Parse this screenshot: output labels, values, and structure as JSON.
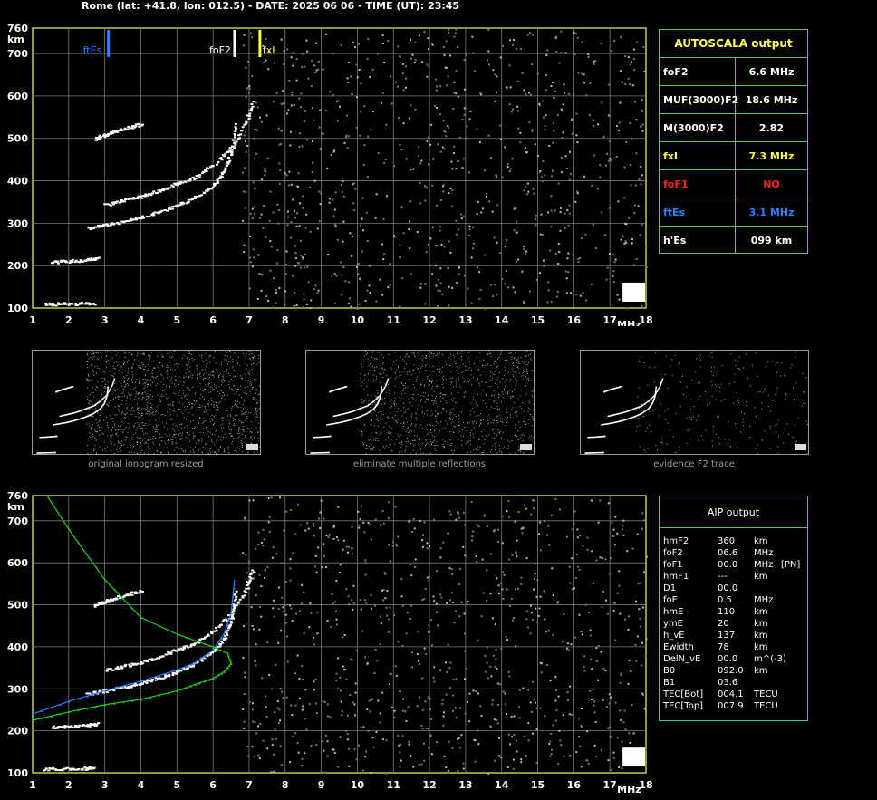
{
  "header": "Rome (lat: +41.8, lon: 012.5) - DATE: 2025 06 06 - TIME (UT): 23:45",
  "colors": {
    "grid": "#7a7a7a",
    "frame": "#c8c84a",
    "yellow": "#ffff33",
    "blue": "#2f7fff",
    "red": "#ff2020",
    "green": "#20d020",
    "trace": "#ffffff"
  },
  "axes": {
    "y_ticks": [
      "760",
      "700",
      "600",
      "500",
      "400",
      "300",
      "200",
      "100"
    ],
    "y_unit": "km",
    "x_ticks": [
      "1",
      "2",
      "3",
      "4",
      "5",
      "6",
      "7",
      "8",
      "9",
      "10",
      "11",
      "12",
      "13",
      "14",
      "15",
      "16",
      "17",
      "18"
    ],
    "x_unit": "MHz"
  },
  "markers": {
    "ftEs_label": "ftEs",
    "foF2_label": "foF2",
    "fxI_label": "fxI"
  },
  "autoscala": {
    "title": "AUTOSCALA output",
    "rows": [
      {
        "key": "foF2",
        "value": "6.6 MHz",
        "color": "#ffffff"
      },
      {
        "key": "MUF(3000)F2",
        "value": "18.6 MHz",
        "color": "#ffffff"
      },
      {
        "key": "M(3000)F2",
        "value": "2.82",
        "color": "#ffffff"
      },
      {
        "key": "fxI",
        "value": "7.3 MHz",
        "color": "#ffff33"
      },
      {
        "key": "foF1",
        "value": "NO",
        "color": "#ff2020"
      },
      {
        "key": "ftEs",
        "value": "3.1 MHz",
        "color": "#2f7fff"
      },
      {
        "key": "h'Es",
        "value": "099    km",
        "color": "#ffffff"
      }
    ]
  },
  "captions": [
    "original ionogram resized",
    "eliminate multiple reflections",
    "evidence F2 trace"
  ],
  "aip": {
    "title": "AIP output",
    "rows": [
      [
        "hmF2",
        "360",
        "km",
        ""
      ],
      [
        "foF2",
        "06.6",
        "MHz",
        ""
      ],
      [
        "foF1",
        "00.0",
        "MHz",
        "[PN]"
      ],
      [
        "hmF1",
        "---",
        "km",
        ""
      ],
      [
        "D1",
        "00.0",
        "",
        ""
      ],
      [
        "foE",
        "0.5",
        "MHz",
        ""
      ],
      [
        "hmE",
        "110",
        "km",
        ""
      ],
      [
        "ymE",
        "20",
        "km",
        ""
      ],
      [
        "h_vE",
        "137",
        "km",
        ""
      ],
      [
        "Ewidth",
        "78",
        "km",
        ""
      ],
      [
        "DelN_vE",
        "00.0",
        "m^(-3)",
        ""
      ],
      [
        "B0",
        "092.0",
        "km",
        ""
      ],
      [
        "B1",
        "03.6",
        "",
        ""
      ],
      [
        "TEC[Bot]",
        "004.1",
        "TECU",
        ""
      ],
      [
        "TEC[Top]",
        "007.9",
        "TECU",
        ""
      ]
    ]
  },
  "chart_data": [
    {
      "type": "scatter",
      "title": "",
      "xlabel": "MHz",
      "ylabel": "km",
      "xlim": [
        1,
        18
      ],
      "ylim": [
        100,
        760
      ],
      "grid": true,
      "annotations": [
        {
          "label": "ftEs",
          "x": 3.1,
          "color": "#2f7fff"
        },
        {
          "label": "foF2",
          "x": 6.6,
          "color": "#ffffff"
        },
        {
          "label": "fxI",
          "x": 7.3,
          "color": "#ffff33"
        }
      ],
      "series": [
        {
          "name": "",
          "points": [
            [
              2.5,
              290
            ],
            [
              3.0,
              297
            ],
            [
              3.5,
              305
            ],
            [
              4.0,
              315
            ],
            [
              4.5,
              328
            ],
            [
              5.0,
              343
            ],
            [
              5.5,
              362
            ],
            [
              6.0,
              392
            ],
            [
              6.3,
              425
            ],
            [
              6.5,
              470
            ],
            [
              6.6,
              540
            ]
          ]
        },
        {
          "name": "",
          "points": [
            [
              3.0,
              345
            ],
            [
              3.5,
              355
            ],
            [
              4.0,
              365
            ],
            [
              4.5,
              378
            ],
            [
              5.0,
              395
            ],
            [
              5.5,
              410
            ],
            [
              6.0,
              440
            ],
            [
              6.5,
              480
            ],
            [
              6.9,
              540
            ],
            [
              7.1,
              590
            ]
          ]
        },
        {
          "name": "",
          "points": [
            [
              2.7,
              500
            ],
            [
              3.0,
              510
            ],
            [
              3.3,
              518
            ],
            [
              3.7,
              528
            ],
            [
              4.0,
              535
            ]
          ]
        },
        {
          "name": "",
          "points": [
            [
              1.5,
              210
            ],
            [
              2.0,
              212
            ],
            [
              2.5,
              215
            ],
            [
              2.8,
              218
            ]
          ]
        },
        {
          "name": "",
          "points": [
            [
              1.3,
              110
            ],
            [
              1.8,
              111
            ],
            [
              2.3,
              112
            ],
            [
              2.7,
              113
            ]
          ]
        }
      ]
    },
    {
      "type": "scatter",
      "title": "",
      "xlabel": "MHz",
      "ylabel": "km",
      "xlim": [
        1,
        18
      ],
      "ylim": [
        100,
        760
      ],
      "grid": true,
      "series": [
        {
          "name": "",
          "points": [
            [
              2.5,
              290
            ],
            [
              3.0,
              297
            ],
            [
              3.5,
              305
            ],
            [
              4.0,
              315
            ],
            [
              4.5,
              328
            ],
            [
              5.0,
              343
            ],
            [
              5.5,
              362
            ],
            [
              6.0,
              392
            ],
            [
              6.3,
              425
            ],
            [
              6.5,
              470
            ],
            [
              6.6,
              540
            ]
          ]
        },
        {
          "name": "",
          "points": [
            [
              3.0,
              345
            ],
            [
              3.5,
              355
            ],
            [
              4.0,
              365
            ],
            [
              4.5,
              378
            ],
            [
              5.0,
              395
            ],
            [
              5.5,
              410
            ],
            [
              6.0,
              440
            ],
            [
              6.5,
              480
            ],
            [
              6.9,
              540
            ],
            [
              7.1,
              590
            ]
          ]
        },
        {
          "name": "",
          "points": [
            [
              2.7,
              500
            ],
            [
              3.0,
              510
            ],
            [
              3.3,
              518
            ],
            [
              3.7,
              528
            ],
            [
              4.0,
              535
            ]
          ]
        },
        {
          "name": "",
          "points": [
            [
              1.5,
              210
            ],
            [
              2.0,
              212
            ],
            [
              2.5,
              215
            ],
            [
              2.8,
              218
            ]
          ]
        },
        {
          "name": "",
          "points": [
            [
              1.3,
              110
            ],
            [
              1.8,
              111
            ],
            [
              2.3,
              112
            ],
            [
              2.7,
              113
            ]
          ]
        },
        {
          "name": "",
          "color": "#2f7fff",
          "points": [
            [
              1.0,
              240
            ],
            [
              2.0,
              270
            ],
            [
              3.0,
              295
            ],
            [
              4.0,
              318
            ],
            [
              5.0,
              345
            ],
            [
              5.5,
              362
            ],
            [
              6.0,
              392
            ],
            [
              6.3,
              430
            ],
            [
              6.5,
              480
            ],
            [
              6.6,
              560
            ]
          ]
        },
        {
          "name": "",
          "color": "#20d020",
          "points": [
            [
              1.0,
              225
            ],
            [
              2.0,
              245
            ],
            [
              3.0,
              262
            ],
            [
              4.0,
              275
            ],
            [
              5.0,
              295
            ],
            [
              5.5,
              310
            ],
            [
              6.0,
              325
            ],
            [
              6.3,
              340
            ],
            [
              6.5,
              360
            ],
            [
              6.4,
              385
            ],
            [
              6.0,
              400
            ],
            [
              5.0,
              430
            ],
            [
              4.0,
              470
            ],
            [
              3.0,
              560
            ],
            [
              2.0,
              680
            ],
            [
              1.4,
              760
            ]
          ]
        }
      ]
    }
  ]
}
